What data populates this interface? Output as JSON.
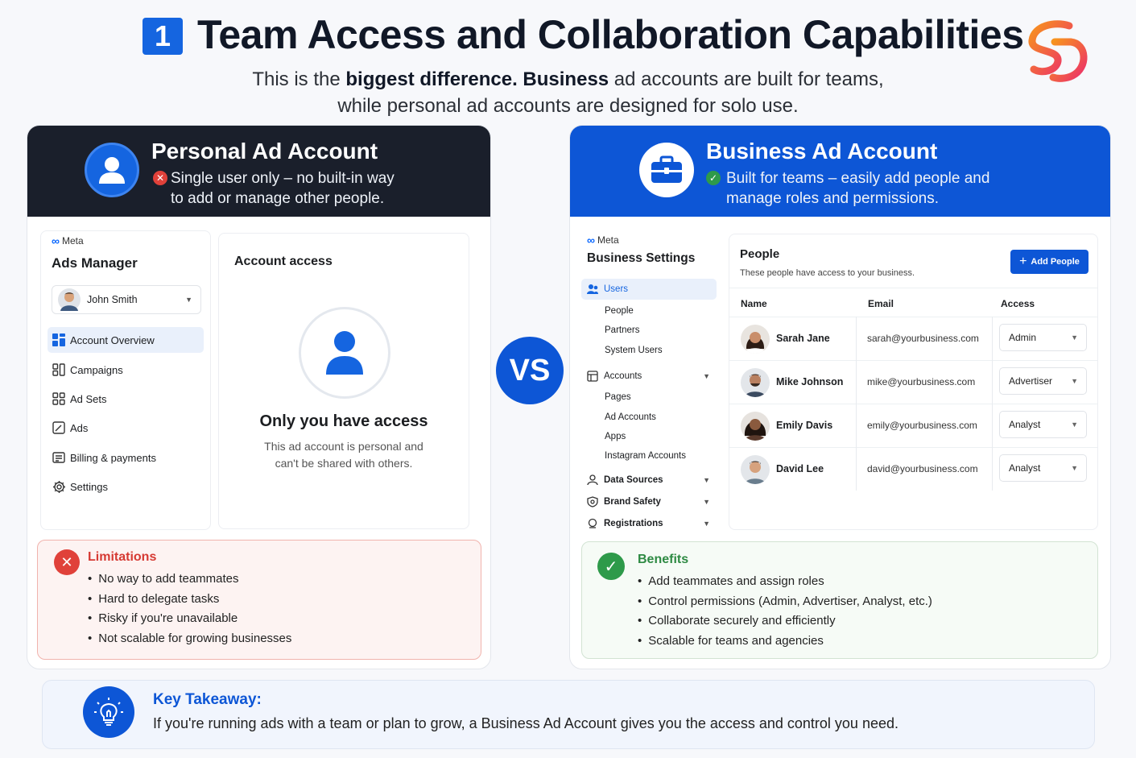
{
  "header": {
    "number": "1",
    "title": "Team Access and Collaboration Capabilities",
    "subtitle_parts": [
      "This is the ",
      "biggest difference.",
      " ",
      "Business",
      " ad accounts are built for teams,"
    ],
    "subtitle_line2": "while personal ad accounts are designed for solo use."
  },
  "personal": {
    "title": "Personal Ad Account",
    "desc_line1": "Single user only – no built-in way",
    "desc_line2": "to add or manage other people.",
    "meta_label": "Meta",
    "app_title": "Ads Manager",
    "user_name": "John Smith",
    "nav": [
      "Account Overview",
      "Campaigns",
      "Ad Sets",
      "Ads",
      "Billing & payments",
      "Settings"
    ],
    "access_title": "Account access",
    "only_you": "Only you have access",
    "only_you_desc1": "This ad account is personal and",
    "only_you_desc2": "can't be shared with others.",
    "limitations_title": "Limitations",
    "limitations": [
      "No way to add teammates",
      "Hard to delegate tasks",
      "Risky if you're unavailable",
      "Not scalable for growing businesses"
    ]
  },
  "vs_label": "VS",
  "business": {
    "title": "Business Ad Account",
    "desc_line1": "Built for teams – easily add people and",
    "desc_line2": "manage roles and permissions.",
    "meta_label": "Meta",
    "app_title": "Business Settings",
    "nav": {
      "users": "Users",
      "people": "People",
      "partners": "Partners",
      "system_users": "System Users",
      "accounts": "Accounts",
      "pages": "Pages",
      "ad_accounts": "Ad Accounts",
      "apps": "Apps",
      "instagram": "Instagram Accounts",
      "data_sources": "Data Sources",
      "brand_safety": "Brand Safety",
      "registrations": "Registrations"
    },
    "people_title": "People",
    "people_desc": "These people have access to your business.",
    "add_button": "Add People",
    "columns": [
      "Name",
      "Email",
      "Access"
    ],
    "rows": [
      {
        "name": "Sarah Jane",
        "email": "sarah@yourbusiness.com",
        "access": "Admin"
      },
      {
        "name": "Mike Johnson",
        "email": "mike@yourbusiness.com",
        "access": "Advertiser"
      },
      {
        "name": "Emily Davis",
        "email": "emily@yourbusiness.com",
        "access": "Analyst"
      },
      {
        "name": "David Lee",
        "email": "david@yourbusiness.com",
        "access": "Analyst"
      }
    ],
    "benefits_title": "Benefits",
    "benefits": [
      "Add teammates and assign roles",
      "Control permissions (Admin, Advertiser, Analyst, etc.)",
      "Collaborate securely and efficiently",
      "Scalable for teams and agencies"
    ]
  },
  "takeaway": {
    "title": "Key Takeaway:",
    "text": "If you're running ads with a team or plan to grow, a Business Ad Account gives you the access and control you need."
  },
  "colors": {
    "accent_blue": "#1565e0",
    "dark_header": "#1a1f2b",
    "business_blue": "#0d56d6",
    "limit_red": "#e0413a",
    "benefit_green": "#2e9a4a"
  }
}
